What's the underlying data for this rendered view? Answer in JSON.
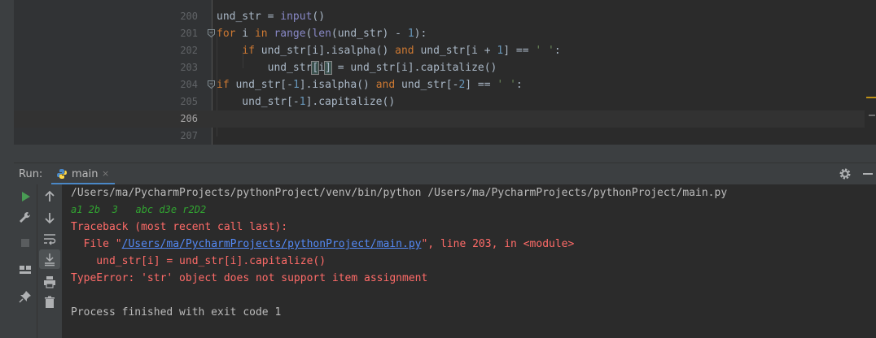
{
  "editor": {
    "lines": [
      {
        "num": "200",
        "code": [
          {
            "t": "und_str = ",
            "c": ""
          },
          {
            "t": "input",
            "c": "fn"
          },
          {
            "t": "()",
            "c": ""
          }
        ]
      },
      {
        "num": "201",
        "code": [
          {
            "t": "for",
            "c": "kw"
          },
          {
            "t": " i ",
            "c": ""
          },
          {
            "t": "in",
            "c": "kw"
          },
          {
            "t": " ",
            "c": ""
          },
          {
            "t": "range",
            "c": "fn"
          },
          {
            "t": "(",
            "c": ""
          },
          {
            "t": "len",
            "c": "fn"
          },
          {
            "t": "(und_str) - ",
            "c": ""
          },
          {
            "t": "1",
            "c": "num"
          },
          {
            "t": "):",
            "c": ""
          }
        ]
      },
      {
        "num": "202",
        "code": [
          {
            "t": "    ",
            "c": ""
          },
          {
            "t": "if",
            "c": "kw"
          },
          {
            "t": " und_str[i].isalpha() ",
            "c": ""
          },
          {
            "t": "and",
            "c": "kw"
          },
          {
            "t": " und_str[i + ",
            "c": ""
          },
          {
            "t": "1",
            "c": "num"
          },
          {
            "t": "] == ",
            "c": ""
          },
          {
            "t": "' '",
            "c": "str"
          },
          {
            "t": ":",
            "c": ""
          }
        ]
      },
      {
        "num": "203",
        "code": [
          {
            "t": "        und_str",
            "c": ""
          },
          {
            "t": "[",
            "c": "hl"
          },
          {
            "t": "i",
            "c": ""
          },
          {
            "t": "]",
            "c": "hl"
          },
          {
            "t": " = und_str[i].capitalize()",
            "c": ""
          }
        ]
      },
      {
        "num": "204",
        "code": [
          {
            "t": "if",
            "c": "kw"
          },
          {
            "t": " und_str[-",
            "c": ""
          },
          {
            "t": "1",
            "c": "num"
          },
          {
            "t": "].isalpha() ",
            "c": ""
          },
          {
            "t": "and",
            "c": "kw"
          },
          {
            "t": " und_str[-",
            "c": ""
          },
          {
            "t": "2",
            "c": "num"
          },
          {
            "t": "] == ",
            "c": ""
          },
          {
            "t": "' '",
            "c": "str"
          },
          {
            "t": ":",
            "c": ""
          }
        ]
      },
      {
        "num": "205",
        "code": [
          {
            "t": "    und_str[-",
            "c": ""
          },
          {
            "t": "1",
            "c": "num"
          },
          {
            "t": "].capitalize()",
            "c": ""
          }
        ]
      },
      {
        "num": "206",
        "code": []
      },
      {
        "num": "207",
        "code": []
      }
    ]
  },
  "run": {
    "label": "Run:",
    "tab_label": "main",
    "close_icon": "×"
  },
  "console": {
    "lines": [
      {
        "parts": [
          {
            "t": "/Users/ma/PycharmProjects/pythonProject/venv/bin/python /Users/ma/PycharmProjects/pythonProject/main.py",
            "c": "c-white"
          }
        ]
      },
      {
        "parts": [
          {
            "t": "a1 2b  3   abc d3e r2D2",
            "c": "c-green"
          }
        ]
      },
      {
        "parts": [
          {
            "t": "Traceback (most recent call last):",
            "c": "c-red"
          }
        ]
      },
      {
        "parts": [
          {
            "t": "  File \"",
            "c": "c-red"
          },
          {
            "t": "/Users/ma/PycharmProjects/pythonProject/main.py",
            "c": "c-link"
          },
          {
            "t": "\", line 203, in <module>",
            "c": "c-red"
          }
        ]
      },
      {
        "parts": [
          {
            "t": "    und_str[i] = und_str[i].capitalize()",
            "c": "c-red"
          }
        ]
      },
      {
        "parts": [
          {
            "t": "TypeError: 'str' object does not support item assignment",
            "c": "c-red"
          }
        ]
      },
      {
        "parts": []
      },
      {
        "parts": [
          {
            "t": "Process finished with exit code 1",
            "c": "c-white"
          }
        ]
      }
    ]
  },
  "icons": {
    "run": "run-icon",
    "wrench": "wrench-icon",
    "stop": "stop-icon",
    "layout": "layout-icon",
    "pin": "pin-icon",
    "up": "arrow-up-icon",
    "down": "arrow-down-icon",
    "wrap": "soft-wrap-icon",
    "scroll": "scroll-to-end-icon",
    "print": "print-icon",
    "trash": "trash-icon",
    "settings": "gear-icon",
    "hide": "hide-icon"
  },
  "colors": {
    "editor_bg": "#2b2b2b",
    "panel_bg": "#3c3f41",
    "tab_underline": "#4a88c7",
    "error_text": "#ff6b68",
    "link": "#548af7",
    "output_green": "#31a531"
  }
}
